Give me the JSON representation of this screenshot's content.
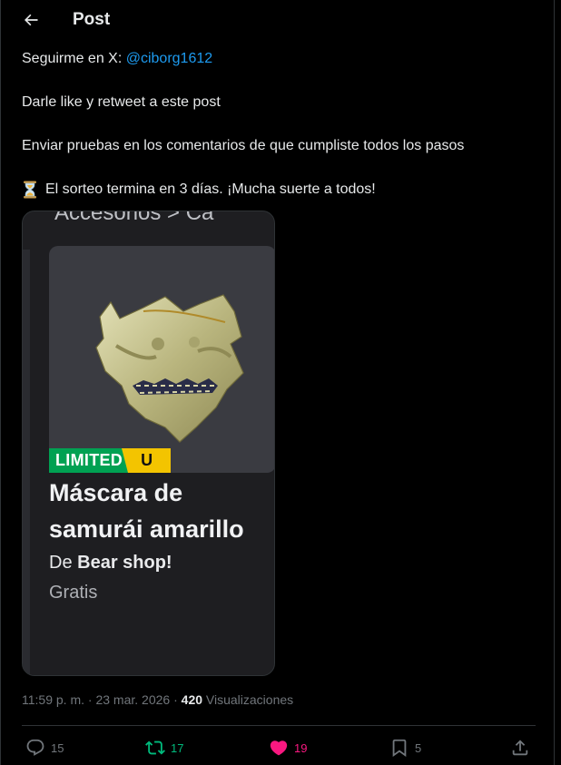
{
  "header": {
    "title": "Post"
  },
  "post": {
    "line1_prefix": "Seguirme en X: ",
    "mention": "@ciborg1612",
    "line2": "Darle like y retweet a este post",
    "line3": "Enviar pruebas en los comentarios de que cumpliste todos los pasos",
    "line4": "El sorteo termina en 3 días. ¡Mucha suerte a todos!",
    "line4_icon": "hourglass-emoji"
  },
  "media": {
    "top_cut_text": "Accesorios > Ca",
    "badge_limited": "LIMITED",
    "badge_u": "U",
    "product_title": "Máscara de samurái amarillo",
    "shop_prefix": "De ",
    "shop_name": "Bear shop!",
    "price": "Gratis",
    "colors": {
      "limited": "#00a152",
      "u": "#f3c400"
    }
  },
  "meta": {
    "time": "11:59 p. m.",
    "date": "23 mar. 2026",
    "views_count": "420",
    "views_label": "Visualizaciones"
  },
  "actions": {
    "replies": "15",
    "retweets": "17",
    "likes": "19",
    "bookmarks": "5",
    "icons": [
      "reply-icon",
      "retweet-icon",
      "heart-icon",
      "bookmark-icon",
      "share-icon"
    ],
    "colors": {
      "retweet": "#00ba7c",
      "like": "#f91880"
    }
  },
  "theme": {
    "background": "#000000",
    "text": "#e7e9ea",
    "link": "#1d9bf0",
    "muted": "#71767b"
  }
}
